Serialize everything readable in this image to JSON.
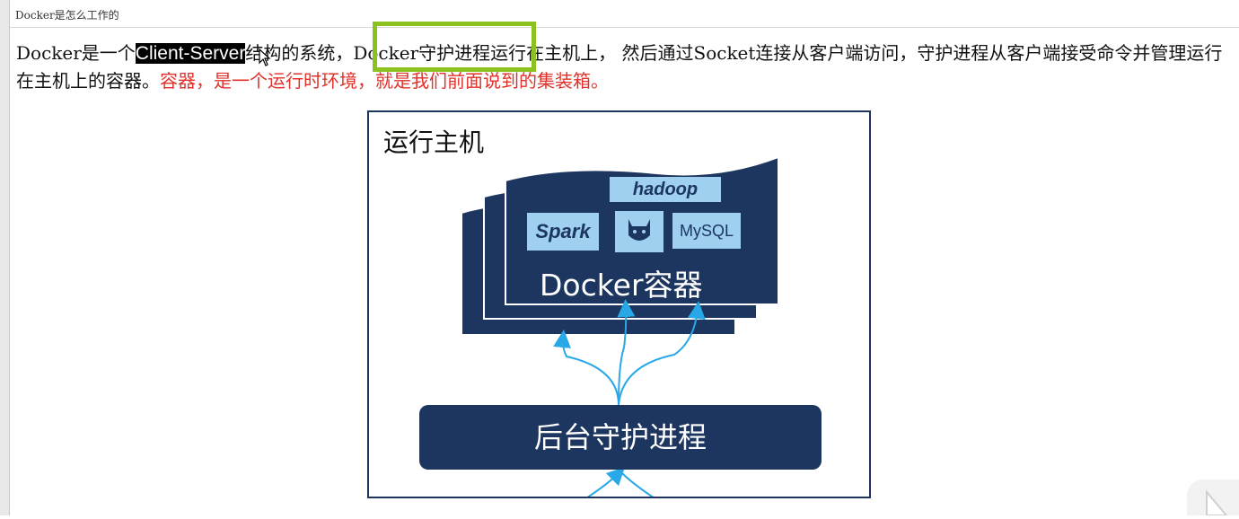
{
  "tab": {
    "title": "Docker是怎么工作的"
  },
  "paragraph": {
    "p1": "Docker是一个",
    "highlight": "Client-Server",
    "p2": "结构的系统，",
    "p3": "Docker守护进程",
    "p4": "运行在主机上，  然后通过Socket连接从客户端访问，守护进程从客户端接受",
    "p5": "命令并管理运行在主机上的容器。",
    "red": "容器，是一个运行时环境，就是我们前面说到的集装箱。"
  },
  "diagram": {
    "host_label": "运行主机",
    "container_label": "Docker容器",
    "daemon_label": "后台守护进程",
    "logos": [
      "hadoop",
      "Spark",
      "MySQL"
    ]
  },
  "colors": {
    "navy": "#1c3660",
    "highlight_box": "#8cc21e",
    "red_text": "#e0322b",
    "arrow": "#29a8e8"
  }
}
